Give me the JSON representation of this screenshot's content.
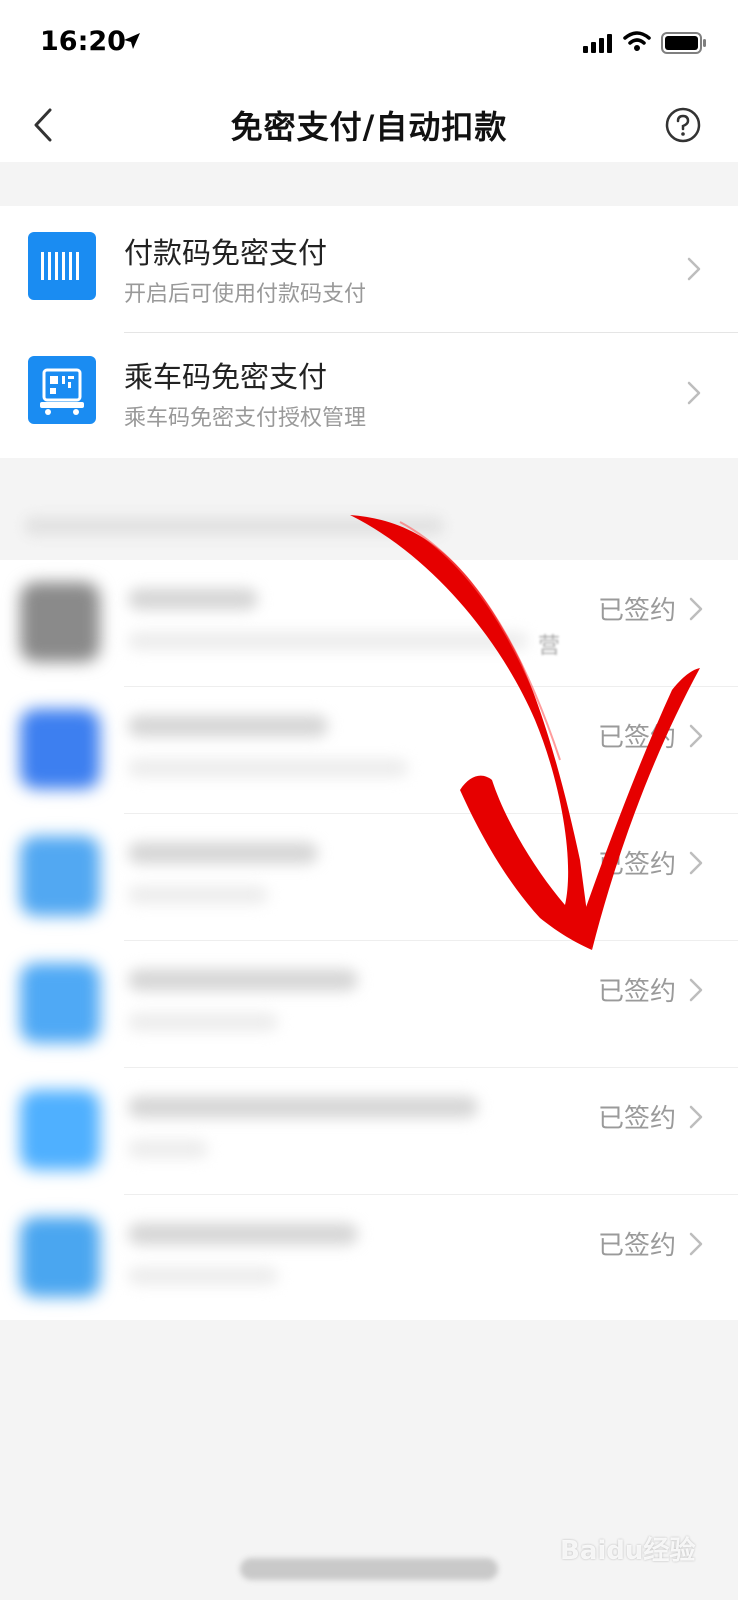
{
  "status_bar": {
    "time": "16:20"
  },
  "nav": {
    "title": "免密支付/自动扣款"
  },
  "card": {
    "items": [
      {
        "title": "付款码免密支付",
        "subtitle": "开启后可使用付款码支付",
        "icon": "barcode-icon"
      },
      {
        "title": "乘车码免密支付",
        "subtitle": "乘车码免密支付授权管理",
        "icon": "bus-qr-icon"
      }
    ]
  },
  "signed_list": {
    "items": [
      {
        "status": "已签约",
        "avatar_color": "#8a8a8a"
      },
      {
        "status": "已签约",
        "avatar_color": "#3d7ff0"
      },
      {
        "status": "已签约",
        "avatar_color": "#52a8f2"
      },
      {
        "status": "已签约",
        "avatar_color": "#4fa9f5"
      },
      {
        "status": "已签约",
        "avatar_color": "#4fb0ff"
      },
      {
        "status": "已签约",
        "avatar_color": "#4aa6f0"
      }
    ],
    "stray_glyph": "营"
  },
  "watermark": "Baidu经验",
  "colors": {
    "accent": "#1a8cf2",
    "arrow": "#e60000"
  }
}
